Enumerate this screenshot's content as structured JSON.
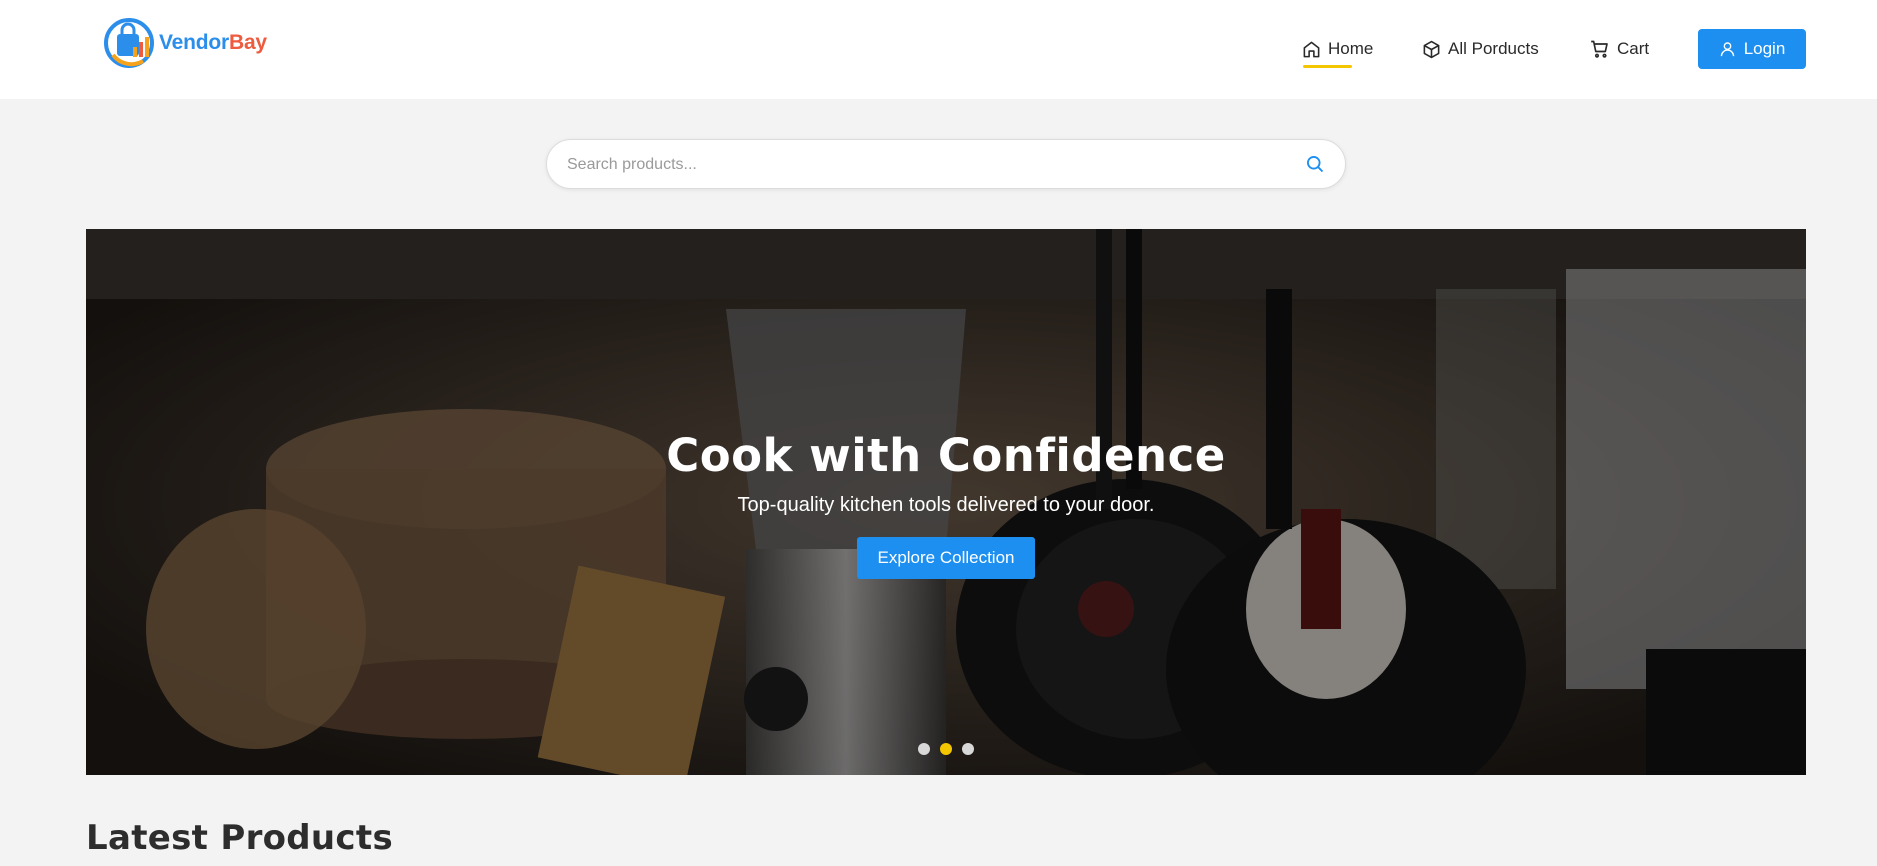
{
  "brand": {
    "name_part1": "Vendor",
    "name_part2": "Bay",
    "color_primary": "#2b8eea",
    "color_secondary": "#ee5b3f"
  },
  "nav": {
    "items": [
      {
        "label": "Home",
        "icon": "home-icon",
        "active": true
      },
      {
        "label": "All Porducts",
        "icon": "box-icon"
      },
      {
        "label": "Cart",
        "icon": "cart-icon"
      }
    ],
    "login_label": "Login",
    "active_underline_color": "#f3c600"
  },
  "search": {
    "placeholder": "Search products..."
  },
  "hero": {
    "title": "Cook with Confidence",
    "subtitle": "Top-quality kitchen tools delivered to your door.",
    "cta_label": "Explore Collection",
    "slides": 3,
    "active_slide": 2
  },
  "section": {
    "latest_title": "Latest Products"
  },
  "colors": {
    "accent": "#1c8ff0",
    "page_bg": "#f3f3f3",
    "dot_active": "#f3c600"
  }
}
